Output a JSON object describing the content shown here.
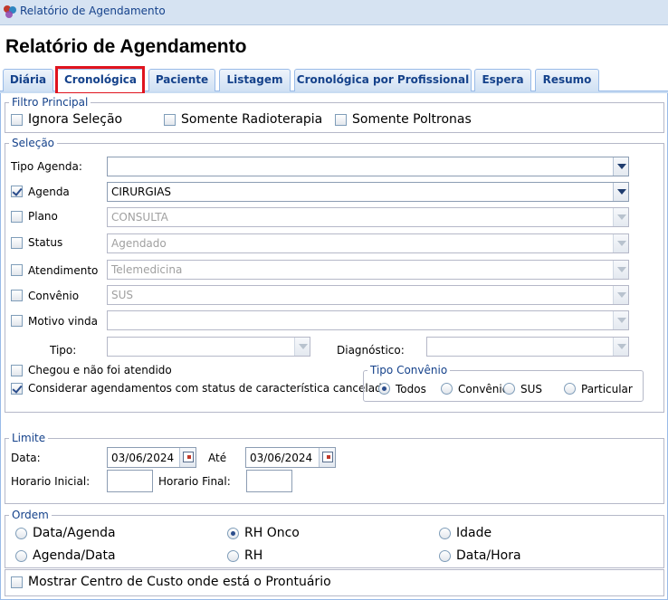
{
  "window": {
    "title": "Relatório de Agendamento"
  },
  "page": {
    "title": "Relatório de Agendamento"
  },
  "tabs": [
    "Diária",
    "Cronológica",
    "Paciente",
    "Listagem",
    "Cronológica por Profissional",
    "Espera",
    "Resumo"
  ],
  "active_tab": "Cronológica",
  "filtro_principal": {
    "legend": "Filtro Principal",
    "ignora_selecao": "Ignora Seleção",
    "somente_radioterapia": "Somente Radioterapia",
    "somente_poltronas": "Somente Poltronas"
  },
  "selecao": {
    "legend": "Seleção",
    "tipo_agenda": {
      "label": "Tipo Agenda:",
      "value": ""
    },
    "agenda": {
      "label": "Agenda",
      "value": "CIRURGIAS",
      "checked": true
    },
    "plano": {
      "label": "Plano",
      "value": "CONSULTA"
    },
    "status": {
      "label": "Status",
      "value": "Agendado"
    },
    "atendimento": {
      "label": "Atendimento",
      "value": "Telemedicina"
    },
    "convenio": {
      "label": "Convênio",
      "value": "SUS"
    },
    "motivo_vinda": {
      "label": "Motivo vinda",
      "value": ""
    },
    "tipo": {
      "label": "Tipo:",
      "value": ""
    },
    "diagnostico": {
      "label": "Diagnóstico:",
      "value": ""
    },
    "chegou": "Chegou e não foi atendido",
    "considerar": "Considerar agendamentos com status de característica cancelado",
    "tipo_convenio": {
      "legend": "Tipo Convênio",
      "options": [
        "Todos",
        "Convênio",
        "SUS",
        "Particular"
      ],
      "selected": "Todos"
    }
  },
  "limite": {
    "legend": "Limite",
    "data_label": "Data:",
    "data_value": "03/06/2024",
    "ate_label": "Até",
    "ate_value": "03/06/2024",
    "horario_inicial_label": "Horario Inicial:",
    "horario_inicial_value": "",
    "horario_final_label": "Horario Final:",
    "horario_final_value": ""
  },
  "ordem": {
    "legend": "Ordem",
    "options": [
      "Data/Agenda",
      "RH Onco",
      "Idade",
      "Agenda/Data",
      "RH",
      "Data/Hora"
    ],
    "selected": "RH Onco"
  },
  "mostrar_centro_custo": "Mostrar Centro de Custo onde está o Prontuário",
  "colors": {
    "accent": "#15428b",
    "tab_border": "#99bbe8",
    "highlight": "#e0141e"
  }
}
